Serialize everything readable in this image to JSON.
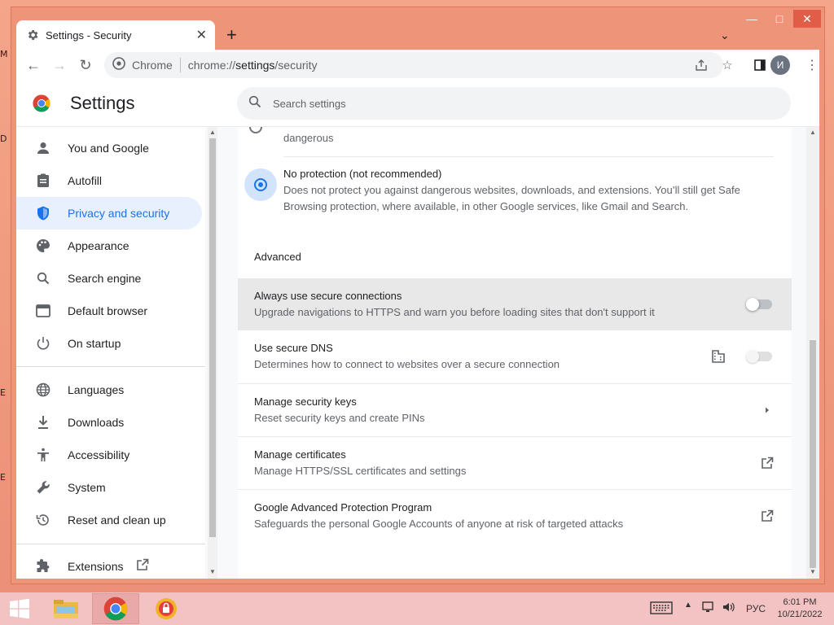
{
  "browser": {
    "tab_title": "Settings - Security",
    "omnibox_label": "Chrome",
    "url_scheme": "chrome://",
    "url_host": "settings",
    "url_path": "/security",
    "profile_initial": "И"
  },
  "settings": {
    "title": "Settings",
    "search_placeholder": "Search settings"
  },
  "sidebar": {
    "items": [
      {
        "label": "You and Google",
        "icon": "person-icon"
      },
      {
        "label": "Autofill",
        "icon": "clipboard-icon"
      },
      {
        "label": "Privacy and security",
        "icon": "shield-icon",
        "active": true
      },
      {
        "label": "Appearance",
        "icon": "palette-icon"
      },
      {
        "label": "Search engine",
        "icon": "search-icon"
      },
      {
        "label": "Default browser",
        "icon": "browser-icon"
      },
      {
        "label": "On startup",
        "icon": "power-icon"
      },
      {
        "label": "Languages",
        "icon": "globe-icon"
      },
      {
        "label": "Downloads",
        "icon": "download-icon"
      },
      {
        "label": "Accessibility",
        "icon": "accessibility-icon"
      },
      {
        "label": "System",
        "icon": "wrench-icon"
      },
      {
        "label": "Reset and clean up",
        "icon": "restore-icon"
      },
      {
        "label": "Extensions",
        "icon": "puzzle-icon"
      }
    ]
  },
  "main": {
    "prev_option_tail": "dangerous",
    "no_protection": {
      "title": "No protection (not recommended)",
      "desc_line1": "Does not protect you against dangerous websites, downloads, and extensions. You’ll still get Safe",
      "desc_line2": "Browsing protection, where available, in other Google services, like Gmail and Search.",
      "selected": true
    },
    "advanced_title": "Advanced",
    "rows": [
      {
        "title": "Always use secure connections",
        "desc": "Upgrade navigations to HTTPS and warn you before loading sites that don't support it",
        "control": "toggle",
        "on": false
      },
      {
        "title": "Use secure DNS",
        "desc": "Determines how to connect to websites over a secure connection",
        "control": "toggle-disabled",
        "on": false
      },
      {
        "title": "Manage security keys",
        "desc": "Reset security keys and create PINs",
        "control": "arrow"
      },
      {
        "title": "Manage certificates",
        "desc": "Manage HTTPS/SSL certificates and settings",
        "control": "external"
      },
      {
        "title": "Google Advanced Protection Program",
        "desc": "Safeguards the personal Google Accounts of anyone at risk of targeted attacks",
        "control": "external"
      }
    ]
  },
  "taskbar": {
    "language": "РУС",
    "time": "6:01 PM",
    "date": "10/21/2022"
  },
  "colors": {
    "accent": "#1a73e8",
    "window_frame": "#ee9479",
    "taskbar": "#f3c2c2"
  }
}
